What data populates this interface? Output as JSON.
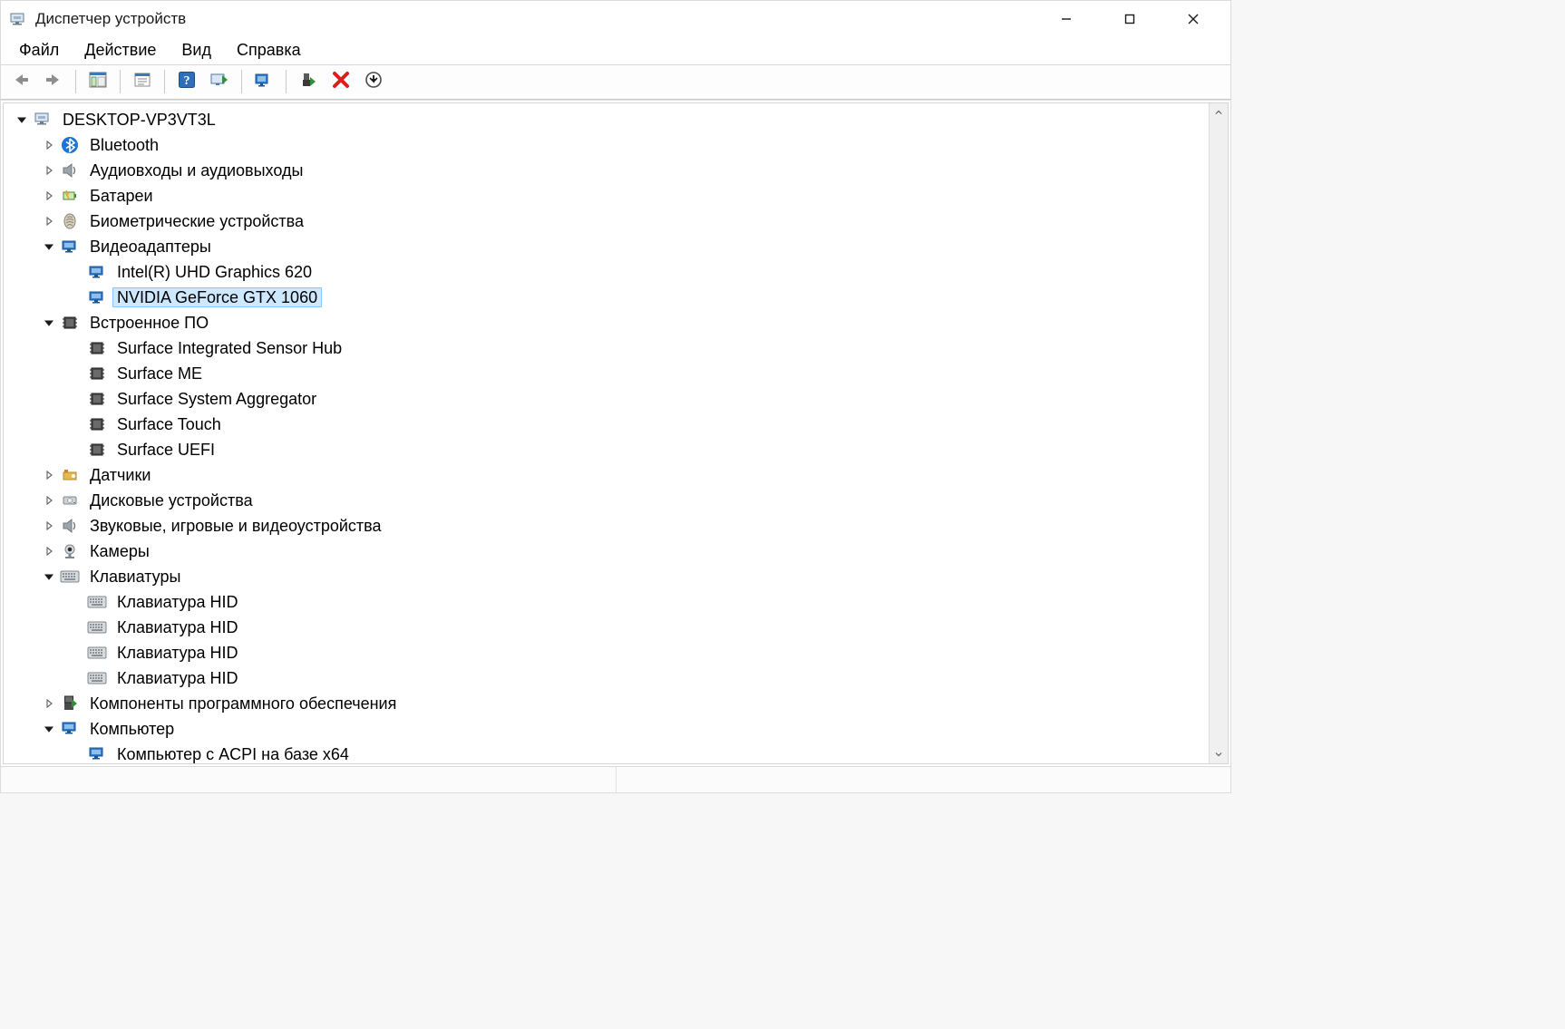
{
  "titlebar": {
    "app_name": "Диспетчер устройств"
  },
  "menubar": {
    "items": [
      "Файл",
      "Действие",
      "Вид",
      "Справка"
    ]
  },
  "toolbar": {
    "buttons": [
      {
        "name": "back",
        "icon": "arrow-left"
      },
      {
        "name": "forward",
        "icon": "arrow-right"
      },
      {
        "sep": true
      },
      {
        "name": "show-hide-tree",
        "icon": "console-tree"
      },
      {
        "sep": true
      },
      {
        "name": "properties",
        "icon": "properties"
      },
      {
        "sep": true
      },
      {
        "name": "help",
        "icon": "help"
      },
      {
        "name": "action-scan",
        "icon": "scan-hardware"
      },
      {
        "sep": true
      },
      {
        "name": "update-driver",
        "icon": "update-driver"
      },
      {
        "sep": true
      },
      {
        "name": "uninstall-device",
        "icon": "uninstall"
      },
      {
        "name": "disable-device",
        "icon": "disable"
      },
      {
        "name": "scan-changes",
        "icon": "scan-circle"
      }
    ]
  },
  "tree": {
    "root": {
      "label": "DESKTOP-VP3VT3L",
      "icon": "computer-root",
      "expanded": true,
      "selected": false,
      "children": [
        {
          "label": "Bluetooth",
          "icon": "bluetooth",
          "expanded": false,
          "hasChildren": true
        },
        {
          "label": "Аудиовходы и аудиовыходы",
          "icon": "audio",
          "expanded": false,
          "hasChildren": true
        },
        {
          "label": "Батареи",
          "icon": "battery",
          "expanded": false,
          "hasChildren": true
        },
        {
          "label": "Биометрические устройства",
          "icon": "biometric",
          "expanded": false,
          "hasChildren": true
        },
        {
          "label": "Видеоадаптеры",
          "icon": "display-adapter",
          "expanded": true,
          "hasChildren": true,
          "children": [
            {
              "label": "Intel(R) UHD Graphics 620",
              "icon": "display-adapter"
            },
            {
              "label": "NVIDIA GeForce GTX 1060",
              "icon": "display-adapter",
              "selected": true
            }
          ]
        },
        {
          "label": "Встроенное ПО",
          "icon": "firmware",
          "expanded": true,
          "hasChildren": true,
          "children": [
            {
              "label": "Surface Integrated Sensor Hub",
              "icon": "firmware"
            },
            {
              "label": "Surface ME",
              "icon": "firmware"
            },
            {
              "label": "Surface System Aggregator",
              "icon": "firmware"
            },
            {
              "label": "Surface Touch",
              "icon": "firmware"
            },
            {
              "label": "Surface UEFI",
              "icon": "firmware"
            }
          ]
        },
        {
          "label": "Датчики",
          "icon": "sensor",
          "expanded": false,
          "hasChildren": true
        },
        {
          "label": "Дисковые устройства",
          "icon": "disk",
          "expanded": false,
          "hasChildren": true
        },
        {
          "label": "Звуковые, игровые и видеоустройства",
          "icon": "audio",
          "expanded": false,
          "hasChildren": true
        },
        {
          "label": "Камеры",
          "icon": "camera",
          "expanded": false,
          "hasChildren": true
        },
        {
          "label": "Клавиатуры",
          "icon": "keyboard",
          "expanded": true,
          "hasChildren": true,
          "children": [
            {
              "label": "Клавиатура HID",
              "icon": "keyboard"
            },
            {
              "label": "Клавиатура HID",
              "icon": "keyboard"
            },
            {
              "label": "Клавиатура HID",
              "icon": "keyboard"
            },
            {
              "label": "Клавиатура HID",
              "icon": "keyboard"
            }
          ]
        },
        {
          "label": "Компоненты программного обеспечения",
          "icon": "software-component",
          "expanded": false,
          "hasChildren": true
        },
        {
          "label": "Компьютер",
          "icon": "computer",
          "expanded": true,
          "hasChildren": true,
          "children": [
            {
              "label": "Компьютер с ACPI на базе x64",
              "icon": "computer"
            }
          ]
        }
      ]
    }
  }
}
